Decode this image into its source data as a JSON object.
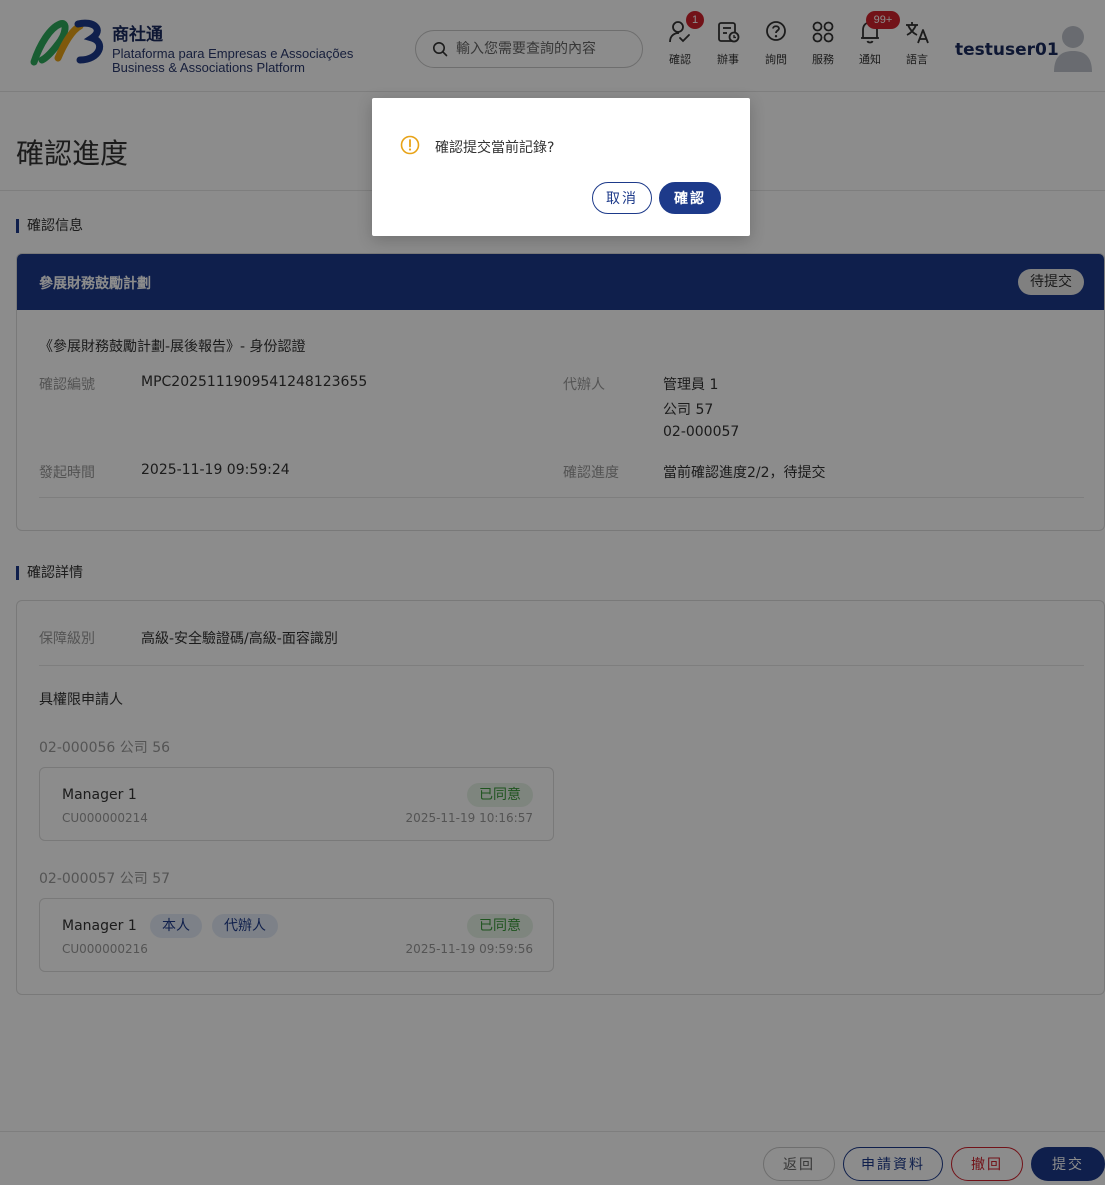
{
  "header": {
    "brand_name": "商社通",
    "brand_sub_1": "Plataforma para Empresas e Associações",
    "brand_sub_2": "Business & Associations Platform",
    "search_placeholder": "輸入您需要查詢的內容",
    "nav": [
      {
        "label": "確認",
        "badge": "1",
        "icon": "confirm-icon"
      },
      {
        "label": "辦事",
        "icon": "affairs-icon"
      },
      {
        "label": "詢問",
        "icon": "question-icon"
      },
      {
        "label": "服務",
        "icon": "services-icon"
      },
      {
        "label": "通知",
        "badge": "99+",
        "icon": "bell-icon"
      },
      {
        "label": "語言",
        "icon": "language-icon"
      }
    ],
    "username": "testuser01"
  },
  "page": {
    "title": "確認進度",
    "section1": "確認信息",
    "section2": "確認詳情"
  },
  "info": {
    "head_title": "參展財務鼓勵計劃",
    "status": "待提交",
    "subtitle": "《參展財務鼓勵計劃-展後報告》- 身份認證",
    "no_label": "確認編號",
    "no_value": "MPC2025111909541248123655",
    "agent_label": "代辦人",
    "agent_line1": "管理員 1",
    "agent_line2": "公司 57",
    "agent_line3": "02-000057",
    "time_label": "發起時間",
    "time_value": "2025-11-19 09:59:24",
    "progress_label": "確認進度",
    "progress_value": "當前確認進度2/2，待提交"
  },
  "detail": {
    "level_label": "保障級別",
    "level_value": "高級-安全驗證碼/高級-面容識別",
    "applicant_title": "具權限申請人",
    "groups": [
      {
        "company": "02-000056 公司 56",
        "name": "Manager 1",
        "id": "CU000000214",
        "status": "已同意",
        "time": "2025-11-19 10:16:57"
      },
      {
        "company": "02-000057 公司 57",
        "name": "Manager 1",
        "tag_self": "本人",
        "tag_agent": "代辦人",
        "id": "CU000000216",
        "status": "已同意",
        "time": "2025-11-19 09:59:56"
      }
    ]
  },
  "footer": {
    "back": "返回",
    "apply_info": "申請資料",
    "withdraw": "撤回",
    "submit": "提交"
  },
  "dialog": {
    "message": "確認提交當前記錄?",
    "cancel": "取消",
    "confirm": "確認"
  },
  "colors": {
    "primary": "#1d3a8a",
    "danger": "#d0222c",
    "success": "#3a9a3a",
    "warning": "#e8a317"
  }
}
